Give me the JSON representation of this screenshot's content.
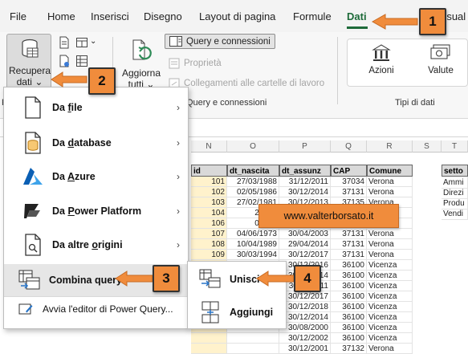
{
  "ribbon": {
    "tabs": [
      "File",
      "Home",
      "Inserisci",
      "Disegno",
      "Layout di pagina",
      "Formule",
      "Dati",
      "Visual"
    ],
    "active_tab": "Dati",
    "get_data": {
      "label_line1": "Recupera",
      "label_line2": "dati",
      "caret": "⌄"
    },
    "refresh_all": {
      "label_line1": "Aggiorna",
      "label_line2": "tutti",
      "caret": "⌄"
    },
    "queries_connections": "Query e connessioni",
    "properties": "Proprietà",
    "workbook_links": "Collegamenti alle cartelle di lavoro",
    "group_queries_label": "Query e connessioni",
    "group_left_cut": "R",
    "stocks": "Azioni",
    "currencies": "Valute",
    "group_datatypes_label": "Tipi di dati",
    "tiny_caret": "⌄"
  },
  "sheet": {
    "columns": [
      "N",
      "O",
      "P",
      "Q",
      "R",
      "S",
      "T"
    ],
    "row_left_cut": "T",
    "headers": [
      "id",
      "dt_nascita",
      "dt_assunz",
      "CAP",
      "Comune"
    ],
    "right_header": "setto",
    "right_values": [
      "Ammi",
      "Direzi",
      "Produ",
      "Vendi"
    ],
    "rows": [
      [
        "101",
        "27/03/1988",
        "31/12/2011",
        "37034",
        "Verona"
      ],
      [
        "102",
        "02/05/1986",
        "30/12/2014",
        "37131",
        "Verona"
      ],
      [
        "103",
        "27/02/1981",
        "30/12/2013",
        "37135",
        "Verona"
      ],
      [
        "104",
        "22/02/",
        "",
        "",
        ""
      ],
      [
        "106",
        "07/09/",
        "",
        "",
        ""
      ],
      [
        "107",
        "04/06/1973",
        "30/04/2003",
        "37131",
        "Verona"
      ],
      [
        "108",
        "10/04/1989",
        "29/04/2014",
        "37131",
        "Verona"
      ],
      [
        "109",
        "30/03/1994",
        "30/12/2017",
        "37131",
        "Verona"
      ],
      [
        "",
        "",
        "30/12/2016",
        "36100",
        "Vicenza"
      ],
      [
        "",
        "",
        "30/12/2014",
        "36100",
        "Vicenza"
      ],
      [
        "",
        "",
        "30/10/2011",
        "36100",
        "Vicenza"
      ],
      [
        "",
        "",
        "30/12/2017",
        "36100",
        "Vicenza"
      ],
      [
        "",
        "",
        "30/12/2018",
        "36100",
        "Vicenza"
      ],
      [
        "",
        "",
        "30/12/2014",
        "36100",
        "Vicenza"
      ],
      [
        "",
        "",
        "30/08/2000",
        "36100",
        "Vicenza"
      ],
      [
        "",
        "",
        "30/12/2002",
        "36100",
        "Vicenza"
      ],
      [
        "",
        "",
        "30/12/2001",
        "37132",
        "Verona"
      ]
    ]
  },
  "menu": {
    "items": [
      {
        "label": "Da file",
        "ul": "f",
        "chevron": "›"
      },
      {
        "label": "Da database",
        "ul": "d",
        "chevron": "›"
      },
      {
        "label": "Da Azure",
        "ul": "A",
        "chevron": "›"
      },
      {
        "label": "Da Power Platform",
        "ul": "P",
        "chevron": "›"
      },
      {
        "label": "Da altre origini",
        "ul": "o",
        "chevron": "›"
      },
      {
        "label": "Combina query",
        "chevron": "›"
      }
    ],
    "editor": "Avvia l'editor di Power Query..."
  },
  "submenu": {
    "merge": "Unisci",
    "append": "Aggiungi"
  },
  "callouts": [
    "1",
    "2",
    "3",
    "4"
  ],
  "watermark": "www.valterborsato.it",
  "colors": {
    "accent": "#1e6b3a",
    "callout": "#f08c3c",
    "id_fill": "#fff2cc"
  }
}
